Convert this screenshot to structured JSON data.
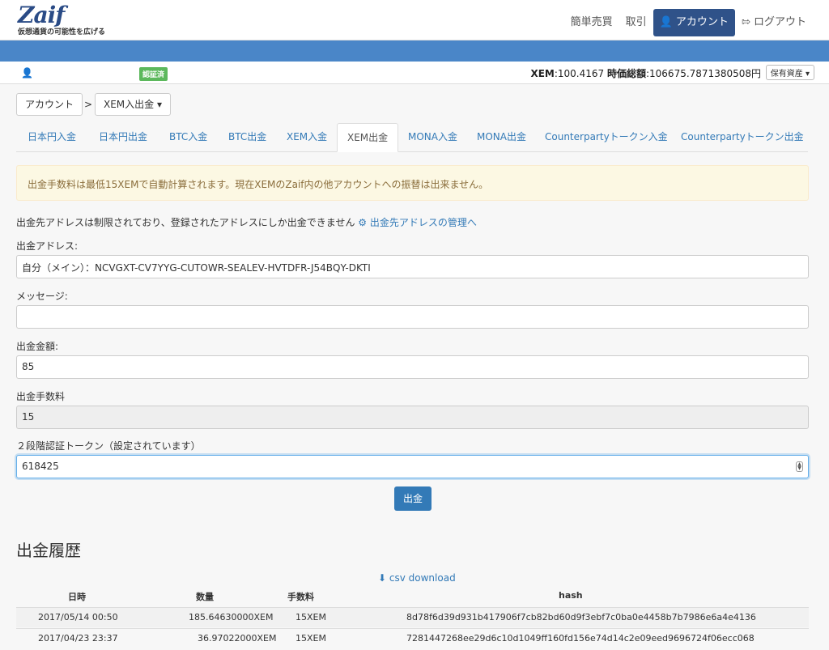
{
  "header": {
    "logo_mark": "Zaif",
    "logo_tagline": "仮想通貨の可能性を広げる",
    "nav": [
      "簡単売買",
      "取引",
      "アカウント",
      "ログアウト"
    ]
  },
  "status": {
    "verified_badge": "認証済",
    "balance_label": "XEM",
    "balance_value": ":100.4167",
    "total_label": "時価総額",
    "total_value": ":106675.7871380508円",
    "asset_button": "保有資産 ▾"
  },
  "breadcrumb": {
    "account": "アカウント",
    "sep": ">",
    "current": "XEM入出金 ▾"
  },
  "tabs": [
    "日本円入金",
    "日本円出金",
    "BTC入金",
    "BTC出金",
    "XEM入金",
    "XEM出金",
    "MONA入金",
    "MONA出金",
    "Counterpartyトークン入金",
    "Counterpartyトークン出金"
  ],
  "alert": "出金手数料は最低15XEMで自動計算されます。現在XEMのZaif内の他アカウントへの振替は出来ません。",
  "note": {
    "text": "出金先アドレスは制限されており、登録されたアドレスにしか出金できません",
    "link": "出金先アドレスの管理へ"
  },
  "form": {
    "address_label": "出金アドレス:",
    "address_value": "自分（メイン）：NCVGXT-CV7YYG-CUTOWR-SEALEV-HVTDFR-J54BQY-DKTI",
    "message_label": "メッセージ:",
    "message_value": "",
    "amount_label": "出金金額:",
    "amount_value": "85",
    "fee_label": "出金手数料",
    "fee_value": "15",
    "token_label": "２段階認証トークン（設定されています）",
    "token_value": "618425",
    "submit": "出金"
  },
  "history": {
    "title": "出金履歴",
    "csv": "csv download",
    "columns": [
      "日時",
      "数量",
      "手数料",
      "hash"
    ],
    "rows": [
      [
        "2017/05/14 00:50",
        "185.64630000XEM",
        "15XEM",
        "8d78f6d39d931b417906f7cb82bd60d9f3ebf7c0ba0e4458b7b7986e6a4e4136"
      ],
      [
        "2017/04/23 23:37",
        "36.97022000XEM",
        "15XEM",
        "7281447268ee29d6c10d1049ff160fd156e74d14c2e09eed9696724f06ecc068"
      ]
    ]
  }
}
